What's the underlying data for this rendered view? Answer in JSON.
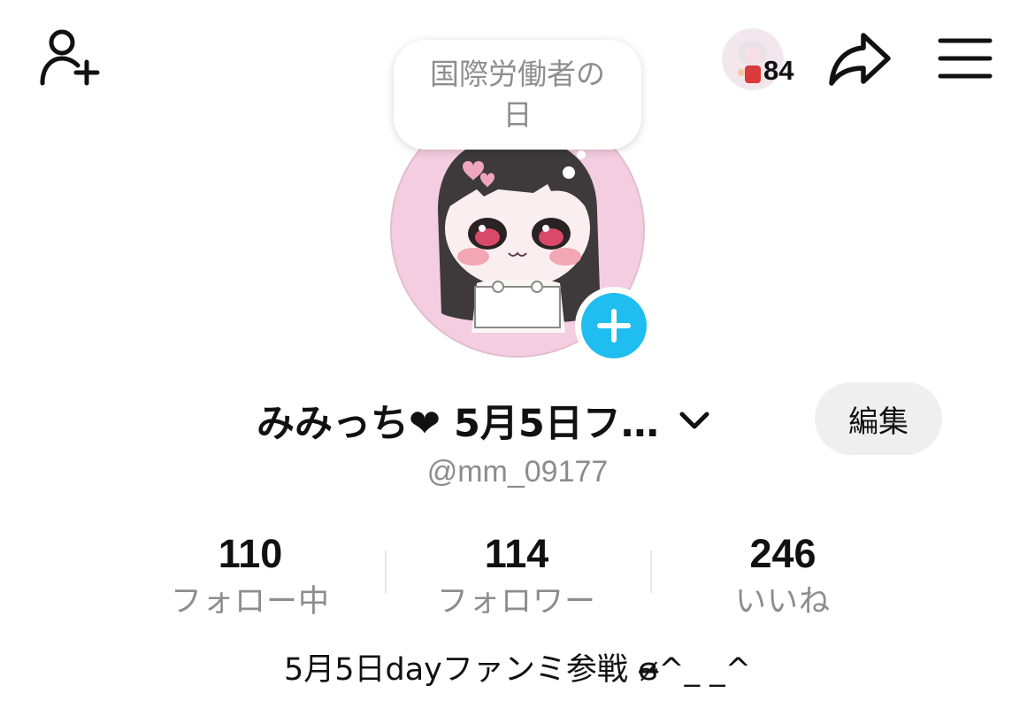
{
  "header": {
    "add_user_icon": "person-plus-icon",
    "visitor_count": "84",
    "share_icon": "share-arrow-icon",
    "menu_icon": "hamburger-menu-icon"
  },
  "bubble": {
    "text": "国際労働者の日"
  },
  "profile": {
    "display_name": "みみっち❤ 5月5日フ…",
    "handle": "@mm_09177",
    "edit_label": "編集",
    "add_story_icon": "plus-icon",
    "chevron_icon": "chevron-down-icon"
  },
  "stats": [
    {
      "value": "110",
      "label": "フォロー中"
    },
    {
      "value": "114",
      "label": "フォロワー"
    },
    {
      "value": "246",
      "label": "いいね"
    }
  ],
  "bio": "5月5日dayファンミ参戦 ɞ̴̶̷^_ _^",
  "colors": {
    "accent": "#1fbdf0",
    "muted_text": "#8c8c8c",
    "button_bg": "#efefef"
  }
}
